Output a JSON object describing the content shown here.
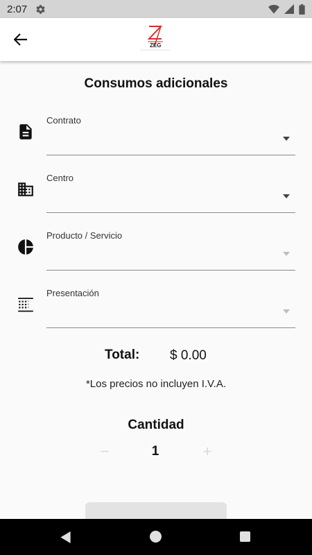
{
  "status_bar": {
    "time": "2:07",
    "icons": [
      "gear-icon",
      "wifi-icon",
      "signal-icon",
      "battery-icon"
    ]
  },
  "app_bar": {
    "back_icon": "arrow-left-icon",
    "logo_text": "ZEG"
  },
  "page": {
    "title": "Consumos adicionales"
  },
  "fields": [
    {
      "label": "Contrato",
      "icon": "document-icon",
      "enabled": true
    },
    {
      "label": "Centro",
      "icon": "building-icon",
      "enabled": true
    },
    {
      "label": "Producto / Servicio",
      "icon": "pie-chart-icon",
      "enabled": false
    },
    {
      "label": "Presentación",
      "icon": "dots-grid-icon",
      "enabled": false
    }
  ],
  "total": {
    "label": "Total:",
    "value": "$ 0.00"
  },
  "price_note": "*Los precios no incluyen I.V.A.",
  "quantity": {
    "title": "Cantidad",
    "minus": "−",
    "value": "1",
    "plus": "+"
  },
  "colors": {
    "status_bar": "#d4d4d4",
    "background": "#fafafa",
    "logo_red": "#d32f2f",
    "nav_bar": "#000000"
  }
}
